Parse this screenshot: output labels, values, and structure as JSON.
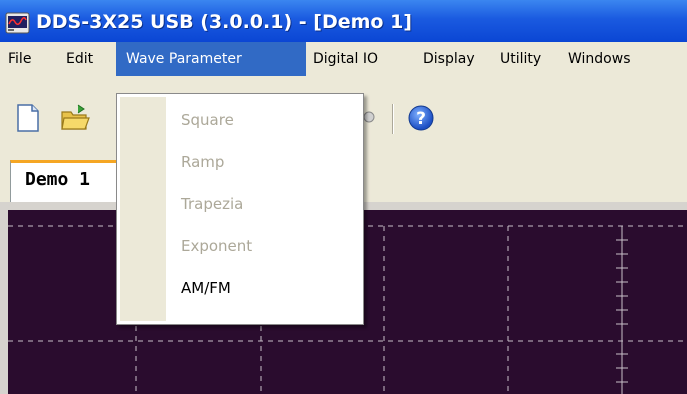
{
  "window": {
    "title": "DDS-3X25 USB (3.0.0.1) - [Demo 1]",
    "icon": "app-waveform-icon"
  },
  "menubar": {
    "items": [
      "File",
      "Edit",
      "Wave Parameter",
      "Digital IO",
      "Display",
      "Utility",
      "Windows"
    ],
    "active": "Wave Parameter"
  },
  "toolbar": {
    "buttons": [
      "new-document-icon",
      "open-folder-icon",
      "circle-icon",
      "help-icon"
    ]
  },
  "tabs": {
    "doc_label": "Demo 1"
  },
  "dropdown": {
    "items": [
      {
        "label": "Square",
        "enabled": false
      },
      {
        "label": "Ramp",
        "enabled": false
      },
      {
        "label": "Trapezia",
        "enabled": false
      },
      {
        "label": "Exponent",
        "enabled": false
      },
      {
        "label": "AM/FM",
        "enabled": true
      }
    ]
  },
  "colors": {
    "titlebar": "#0b46d4",
    "menu_highlight": "#316ac5",
    "scope_background": "#2a0c2e",
    "grid": "#c8c0c8"
  }
}
